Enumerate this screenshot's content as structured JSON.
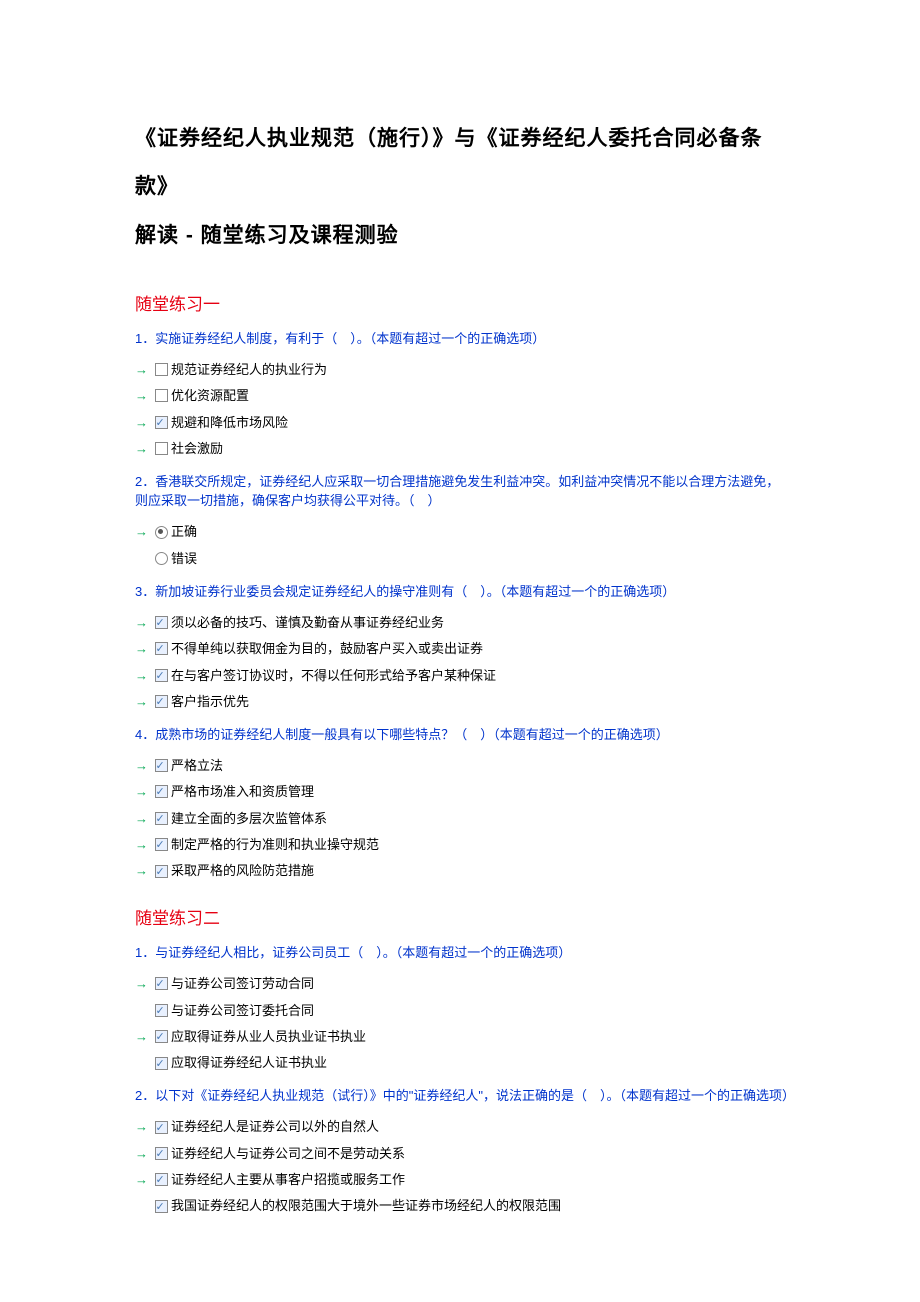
{
  "titleLine1": "《证券经纪人执业规范（施行）》与《证券经纪人委托合同必备条款》",
  "titleLine2": "解读 - 随堂练习及课程测验",
  "sections": [
    {
      "title": "随堂练习一",
      "questions": [
        {
          "text": "1．实施证券经纪人制度，有利于（　）。（本题有超过一个的正确选项）",
          "type": "checkbox",
          "options": [
            {
              "label": "规范证券经纪人的执业行为",
              "arrow": true,
              "checked": false
            },
            {
              "label": "优化资源配置",
              "arrow": true,
              "checked": false
            },
            {
              "label": "规避和降低市场风险",
              "arrow": true,
              "checked": true
            },
            {
              "label": "社会激励",
              "arrow": true,
              "checked": false
            }
          ]
        },
        {
          "text": "2．香港联交所规定，证券经纪人应采取一切合理措施避免发生利益冲突。如利益冲突情况不能以合理方法避免，则应采取一切措施，确保客户均获得公平对待。（　）",
          "type": "radio",
          "options": [
            {
              "label": "正确",
              "arrow": true,
              "selected": true
            },
            {
              "label": "错误",
              "arrow": false,
              "selected": false
            }
          ]
        },
        {
          "text": "3．新加坡证券行业委员会规定证券经纪人的操守准则有（　）。（本题有超过一个的正确选项）",
          "type": "checkbox",
          "options": [
            {
              "label": "须以必备的技巧、谨慎及勤奋从事证券经纪业务",
              "arrow": true,
              "checked": true
            },
            {
              "label": "不得单纯以获取佣金为目的，鼓励客户买入或卖出证券",
              "arrow": true,
              "checked": true
            },
            {
              "label": "在与客户签订协议时，不得以任何形式给予客户某种保证",
              "arrow": true,
              "checked": true
            },
            {
              "label": "客户指示优先",
              "arrow": true,
              "checked": true
            }
          ]
        },
        {
          "text": "4．成熟市场的证券经纪人制度一般具有以下哪些特点？（　）（本题有超过一个的正确选项）",
          "type": "checkbox",
          "options": [
            {
              "label": "严格立法",
              "arrow": true,
              "checked": true
            },
            {
              "label": "严格市场准入和资质管理",
              "arrow": true,
              "checked": true
            },
            {
              "label": "建立全面的多层次监管体系",
              "arrow": true,
              "checked": true
            },
            {
              "label": "制定严格的行为准则和执业操守规范",
              "arrow": true,
              "checked": true
            },
            {
              "label": "采取严格的风险防范措施",
              "arrow": true,
              "checked": true
            }
          ]
        }
      ]
    },
    {
      "title": "随堂练习二",
      "questions": [
        {
          "text": "1．与证券经纪人相比，证券公司员工（　）。（本题有超过一个的正确选项）",
          "type": "checkbox",
          "options": [
            {
              "label": "与证券公司签订劳动合同",
              "arrow": true,
              "checked": true
            },
            {
              "label": "与证券公司签订委托合同",
              "arrow": false,
              "checked": true
            },
            {
              "label": "应取得证券从业人员执业证书执业",
              "arrow": true,
              "checked": true
            },
            {
              "label": "应取得证券经纪人证书执业",
              "arrow": false,
              "checked": true
            }
          ]
        },
        {
          "text": "2．以下对《证券经纪人执业规范（试行）》中的\"证券经纪人\"，说法正确的是（　）。（本题有超过一个的正确选项）",
          "type": "checkbox",
          "options": [
            {
              "label": "证券经纪人是证券公司以外的自然人",
              "arrow": true,
              "checked": true
            },
            {
              "label": "证券经纪人与证券公司之间不是劳动关系",
              "arrow": true,
              "checked": true
            },
            {
              "label": "证券经纪人主要从事客户招揽或服务工作",
              "arrow": true,
              "checked": true
            },
            {
              "label": "我国证券经纪人的权限范围大于境外一些证券市场经纪人的权限范围",
              "arrow": false,
              "checked": true
            }
          ]
        }
      ]
    }
  ]
}
